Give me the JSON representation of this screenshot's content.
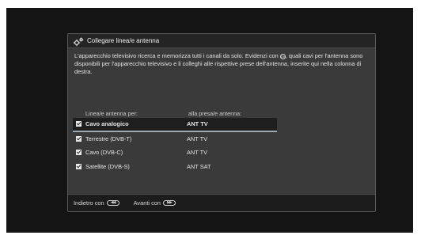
{
  "dialog": {
    "title": "Collegare linea/e antenna",
    "description_part1": "L'apparecchio televisivo ricerca e memorizza tutti i canali da solo. Evidenzi con ",
    "ok_symbol": "OK",
    "description_part2": ", quali cavi per l'antenna sono disponibili per l'apparecchio televisivo e li colleghi alle rispettive prese dell'antenna, inserite qui nella colonna di destra."
  },
  "table": {
    "header_left": "Linea/e antenna per:",
    "header_right": "alla presa/e antenna:",
    "rows": [
      {
        "label": "Cavo analogico",
        "value": "ANT TV",
        "checked": true,
        "selected": true
      },
      {
        "label": "Terrestre (DVB-T)",
        "value": "ANT TV",
        "checked": true,
        "selected": false
      },
      {
        "label": "Cavo (DVB-C)",
        "value": "ANT TV",
        "checked": true,
        "selected": false
      },
      {
        "label": "Satellite (DVB-S)",
        "value": "ANT SAT",
        "checked": true,
        "selected": false
      }
    ]
  },
  "footer": {
    "back_label": "Indietro con",
    "back_icon": "rewind-button-icon",
    "back_symbol": "◀◀",
    "forward_label": "Avanti con",
    "forward_icon": "fast-forward-button-icon",
    "forward_symbol": "▶▶"
  },
  "colors": {
    "screen_bg": "#141414",
    "dialog_bg": "#3a3a3a",
    "selection_underline": "#9aa8b4"
  }
}
